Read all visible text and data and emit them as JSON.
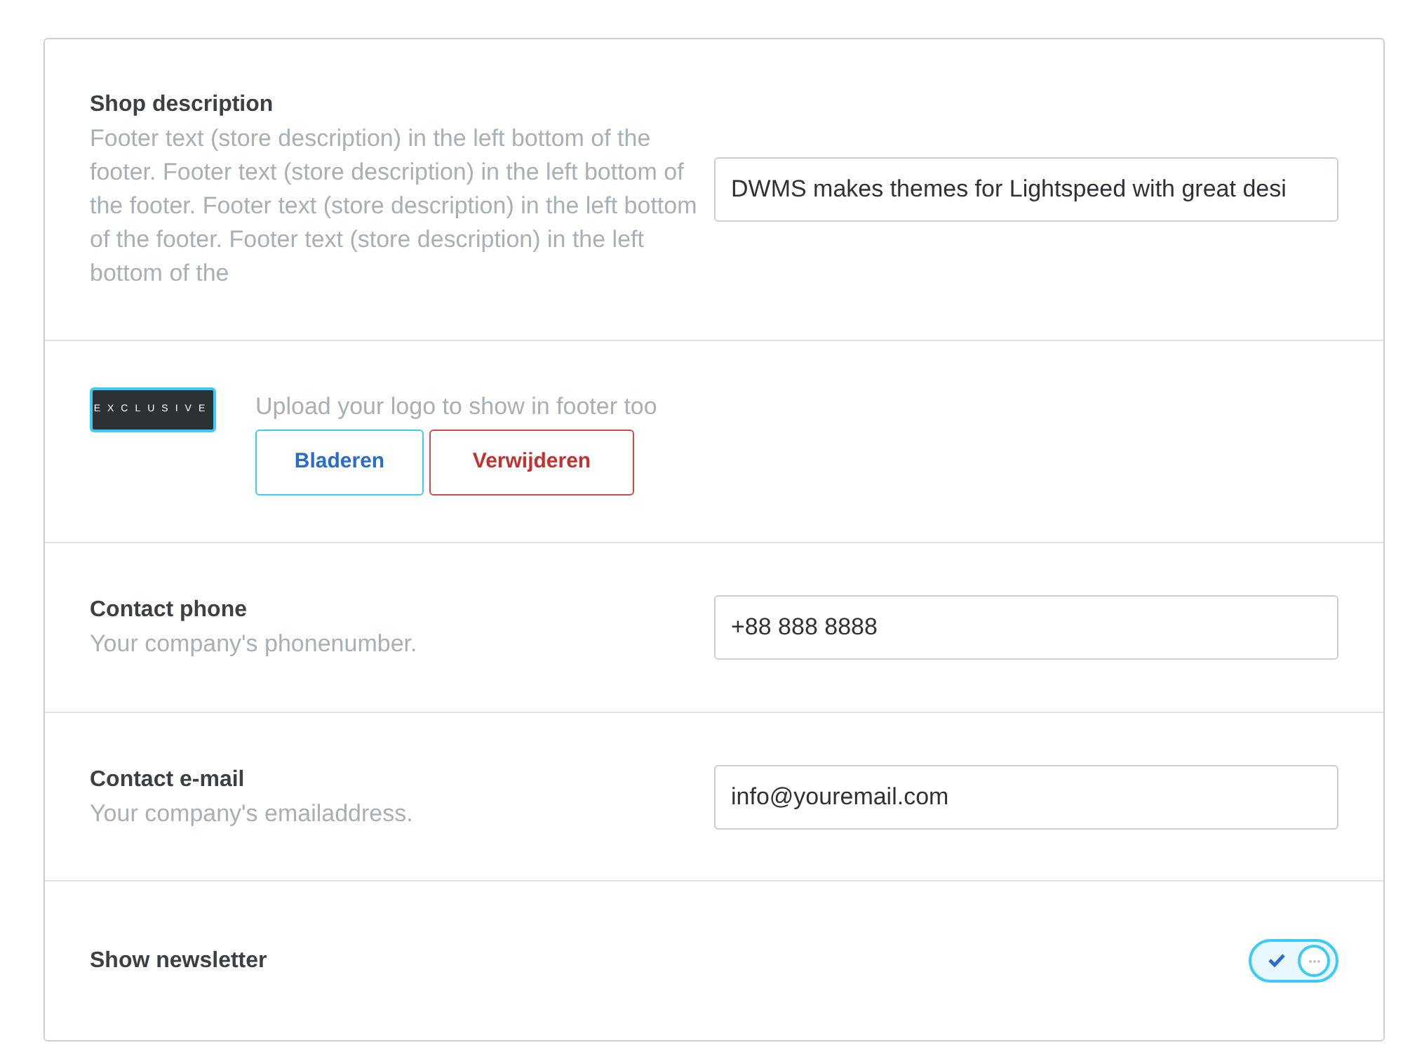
{
  "settings": [
    {
      "kind": "text",
      "label": "Shop description",
      "help": "Footer text (store description) in the left bottom of the footer. Footer text (store description) in the left bottom of the footer. Footer text (store description) in the left bottom of the footer. Footer text (store description) in the left bottom of the",
      "value": "DWMS makes themes for Lightspeed with great desi"
    },
    {
      "kind": "logo",
      "logo_text": "EXCLUSIVE",
      "help": "Upload your logo to show in footer too",
      "buttons": [
        {
          "label": "Bladeren",
          "kind": "browse"
        },
        {
          "label": "Verwijderen",
          "kind": "remove"
        }
      ]
    },
    {
      "kind": "text",
      "label": "Contact phone",
      "help": "Your company's phonenumber.",
      "value": "+88 888 8888"
    },
    {
      "kind": "text",
      "label": "Contact e-mail",
      "help": "Your company's emailaddress.",
      "value": "info@youremail.com"
    },
    {
      "kind": "toggle",
      "label": "Show newsletter",
      "on": true
    }
  ]
}
